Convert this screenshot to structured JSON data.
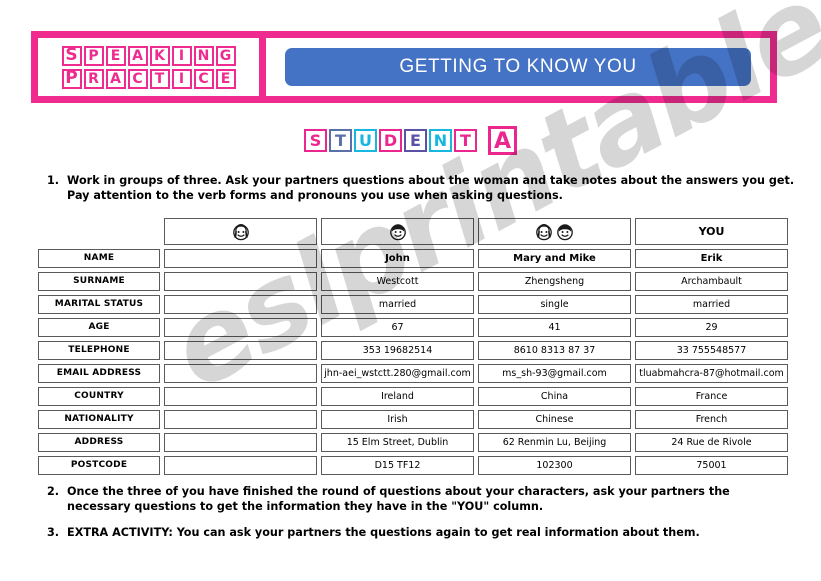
{
  "header": {
    "logo_line1": "SPEAKING",
    "logo_line2": "PRACTICE",
    "banner_title": "GETTING TO KNOW YOU",
    "banner_color": "#4472c4",
    "frame_color": "#ef2b8f"
  },
  "student_title": {
    "word": "STUDENT",
    "letter_colors": [
      "#ec268f",
      "#5b6fa8",
      "#16b8e0",
      "#ec268f",
      "#5b52a8",
      "#16b8e0",
      "#ec268f"
    ],
    "solo_letter": "A",
    "solo_color": "#ec268f"
  },
  "instructions": [
    {
      "number": "1.",
      "text": "Work in groups of three. Ask your partners questions about the woman and take notes about the answers you get. Pay attention to the verb forms and pronouns you use when asking questions."
    },
    {
      "number": "2.",
      "text": "Once the three of you have finished the round of questions about your characters, ask your partners the necessary questions to get the information they have in the \"YOU\" column."
    },
    {
      "number": "3.",
      "text": "EXTRA ACTIVITY: You can ask your partners the questions again to get real information about them."
    }
  ],
  "table": {
    "column_headers": [
      {
        "type": "blank",
        "label": ""
      },
      {
        "type": "icon",
        "icon": "woman-face-icon",
        "label": ""
      },
      {
        "type": "icon",
        "icon": "man-face-icon",
        "label": ""
      },
      {
        "type": "icon",
        "icon": "couple-face-icon",
        "label": ""
      },
      {
        "type": "text",
        "icon": "",
        "label": "YOU"
      }
    ],
    "rows": [
      {
        "label": "NAME",
        "blank": "",
        "john": "John",
        "marymike": "Mary and Mike",
        "you": "Erik"
      },
      {
        "label": "SURNAME",
        "blank": "",
        "john": "Westcott",
        "marymike": "Zhengsheng",
        "you": "Archambault"
      },
      {
        "label": "MARITAL STATUS",
        "blank": "",
        "john": "married",
        "marymike": "single",
        "you": "married"
      },
      {
        "label": "AGE",
        "blank": "",
        "john": "67",
        "marymike": "41",
        "you": "29"
      },
      {
        "label": "TELEPHONE",
        "blank": "",
        "john": "353 19682514",
        "marymike": "8610 8313 87 37",
        "you": "33 755548577"
      },
      {
        "label": "EMAIL ADDRESS",
        "blank": "",
        "john": "jhn-aei_wstctt.280@gmail.com",
        "marymike": "ms_sh-93@gmail.com",
        "you": "tluabmahcra-87@hotmail.com"
      },
      {
        "label": "COUNTRY",
        "blank": "",
        "john": "Ireland",
        "marymike": "China",
        "you": "France"
      },
      {
        "label": "NATIONALITY",
        "blank": "",
        "john": "Irish",
        "marymike": "Chinese",
        "you": "French"
      },
      {
        "label": "ADDRESS",
        "blank": "",
        "john": "15 Elm Street, Dublin",
        "marymike": "62 Renmin Lu, Beijing",
        "you": "24 Rue de Rivole"
      },
      {
        "label": "POSTCODE",
        "blank": "",
        "john": "D15 TF12",
        "marymike": "102300",
        "you": "75001"
      }
    ]
  },
  "watermark": {
    "text": "eslprintables.com"
  }
}
